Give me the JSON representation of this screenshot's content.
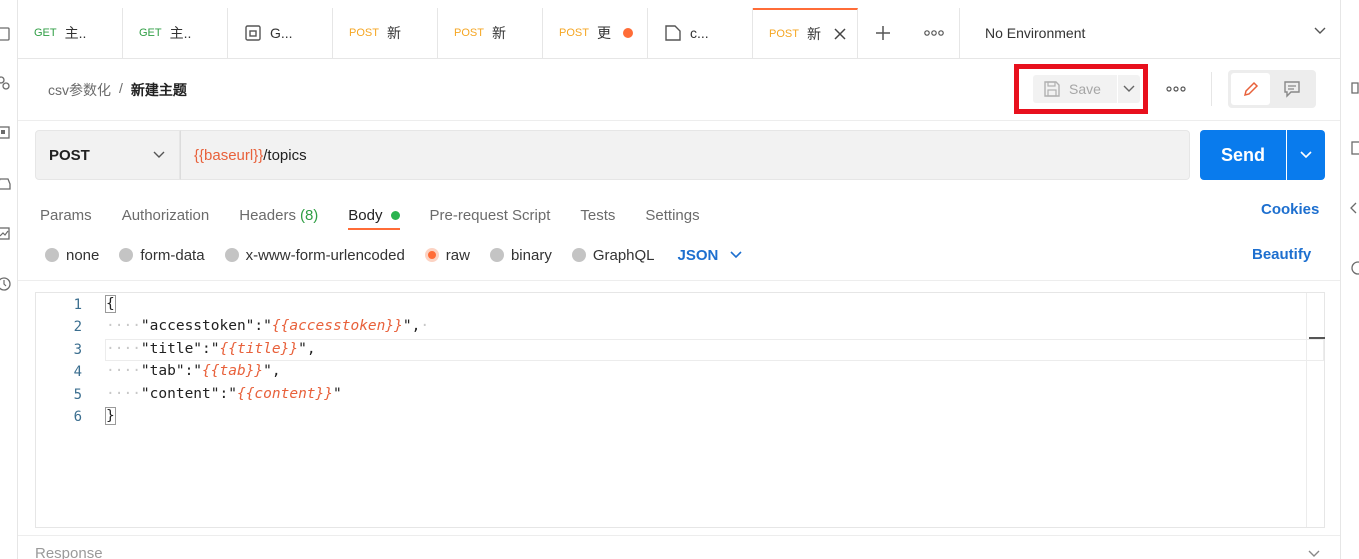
{
  "tabs": [
    {
      "method": "GET",
      "name": "主.."
    },
    {
      "method": "GET",
      "name": "主.."
    },
    {
      "method": "",
      "name": "G..."
    },
    {
      "method": "POST",
      "name": "新"
    },
    {
      "method": "POST",
      "name": "新"
    },
    {
      "method": "POST",
      "name": "更"
    },
    {
      "method": "",
      "name": "c..."
    },
    {
      "method": "POST",
      "name": "新"
    }
  ],
  "environment": {
    "label": "No Environment"
  },
  "breadcrumb": {
    "parent": "csv参数化",
    "separator": "/",
    "current": "新建主题"
  },
  "toolbar": {
    "save_label": "Save"
  },
  "request": {
    "method": "POST",
    "url_variable": "{{baseurl}}",
    "url_path": "/topics",
    "send_label": "Send"
  },
  "request_tabs": {
    "params": "Params",
    "authorization": "Authorization",
    "headers": "Headers",
    "headers_count": "(8)",
    "body": "Body",
    "prerequest": "Pre-request Script",
    "tests": "Tests",
    "settings": "Settings",
    "cookies": "Cookies"
  },
  "body_types": {
    "none": "none",
    "form_data": "form-data",
    "urlencoded": "x-www-form-urlencoded",
    "raw": "raw",
    "binary": "binary",
    "graphql": "GraphQL",
    "format": "JSON",
    "beautify": "Beautify"
  },
  "editor": {
    "line_numbers": [
      "1",
      "2",
      "3",
      "4",
      "5",
      "6"
    ],
    "open_brace": "{",
    "close_brace": "}",
    "lines": [
      {
        "key": "\"accesstoken\"",
        "value": "{{accesstoken}}",
        "trail": ","
      },
      {
        "key": "\"title\"",
        "value": "{{title}}",
        "trail": ","
      },
      {
        "key": "\"tab\"",
        "value": "{{tab}}",
        "trail": ","
      },
      {
        "key": "\"content\"",
        "value": "{{content}}",
        "trail": ""
      }
    ]
  },
  "response": {
    "label": "Response"
  },
  "colors": {
    "accent": "#ff6c37",
    "send": "#097bed",
    "link": "#1d6fcf",
    "highlight_box": "#e8101d"
  }
}
